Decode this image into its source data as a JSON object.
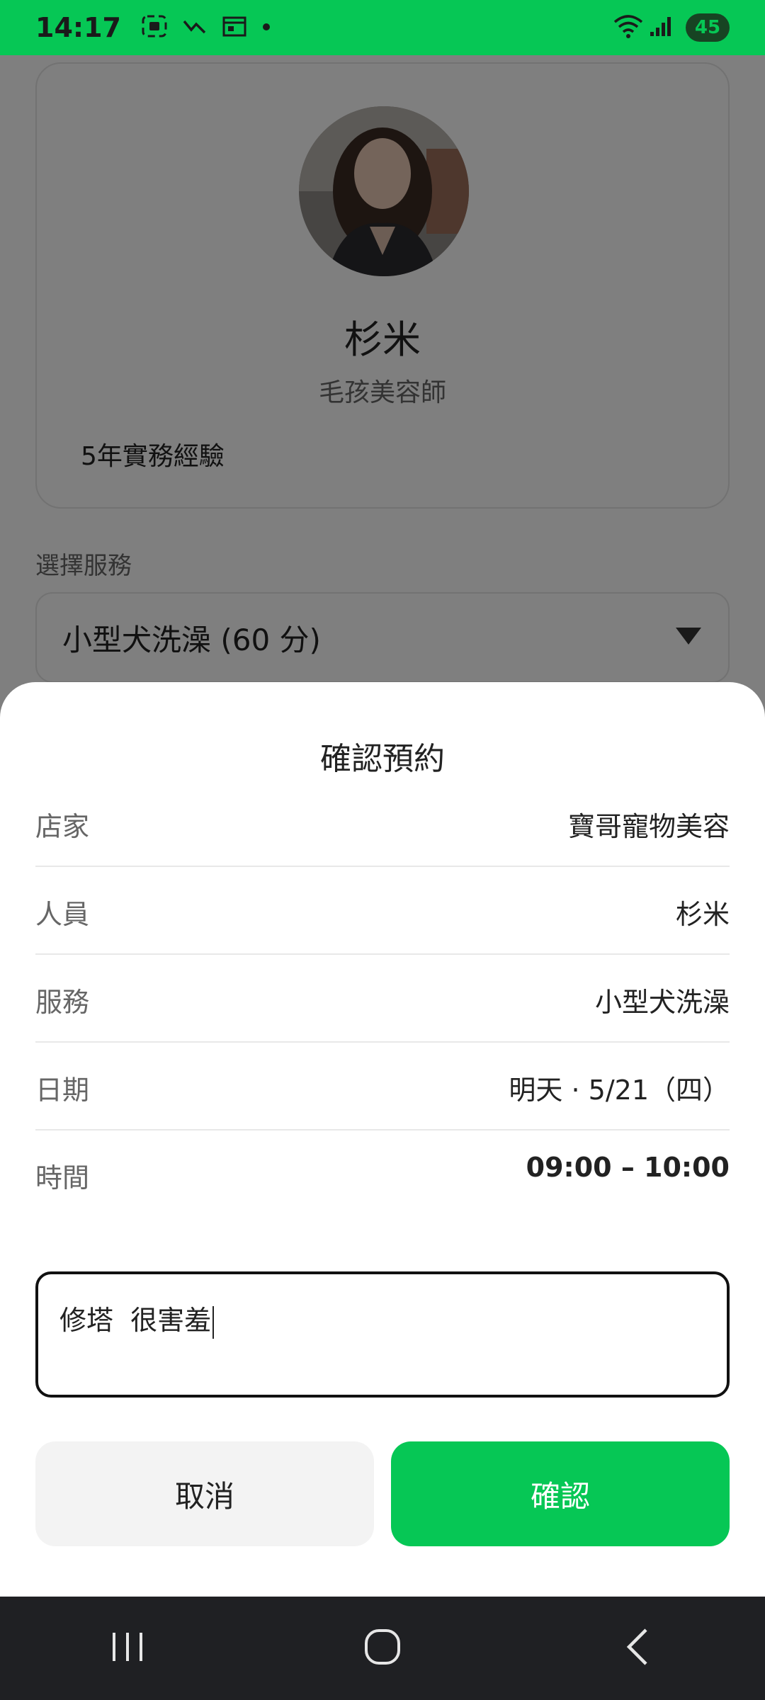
{
  "status_bar": {
    "time": "14:17",
    "battery": "45",
    "bg_color": "#06c755"
  },
  "profile": {
    "name": "杉米",
    "role": "毛孩美容師",
    "experience": "5年實務經驗"
  },
  "service": {
    "section_label": "選擇服務",
    "selected": "小型犬洗澡 (60 分)"
  },
  "sheet": {
    "title": "確認預約",
    "rows": [
      {
        "label": "店家",
        "value": "寶哥寵物美容"
      },
      {
        "label": "人員",
        "value": "杉米"
      },
      {
        "label": "服務",
        "value": "小型犬洗澡"
      },
      {
        "label": "日期",
        "value": "明天 · 5/21（四）"
      },
      {
        "label": "時間",
        "value": "09:00 – 10:00"
      }
    ],
    "note_value": "修塔  很害羞",
    "cancel_label": "取消",
    "confirm_label": "確認"
  },
  "colors": {
    "accent": "#06c755",
    "nav_bg": "#1f2023"
  }
}
